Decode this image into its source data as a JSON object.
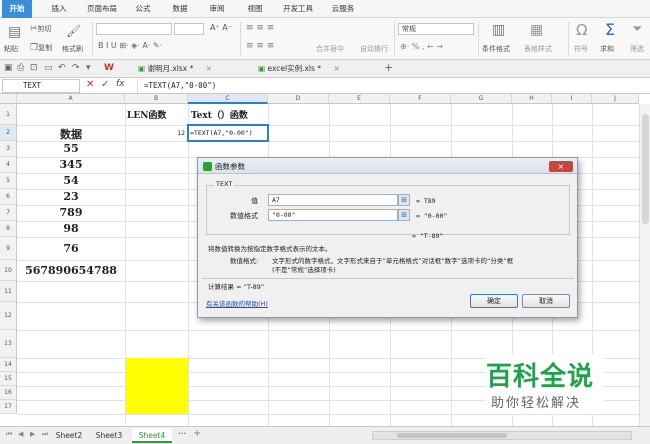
{
  "menu": {
    "tabs": [
      "开始",
      "插入",
      "页面布局",
      "公式",
      "数据",
      "审阅",
      "视图",
      "开发工具",
      "云服务"
    ],
    "active": "开始"
  },
  "ribbon": {
    "cut": "剪切",
    "copy": "复制",
    "format_painter": "格式刷",
    "paste": "粘贴",
    "merge_center": "合并居中",
    "auto_wrap": "自动换行",
    "number_format": "常规",
    "conditional_format": "条件格式",
    "table_style": "表格样式",
    "symbol": "符号",
    "sum": "求和",
    "filter": "筛选"
  },
  "doc_tabs": [
    {
      "label": "谢明月.xlsx *",
      "close": "×"
    },
    {
      "label": "excel实例.xls *",
      "close": "×"
    }
  ],
  "formula_bar": {
    "name_box": "TEXT",
    "fx": "fx",
    "formula": "=TEXT(A7,\"0-00\")"
  },
  "grid": {
    "columns": [
      "A",
      "B",
      "C",
      "D",
      "E",
      "F",
      "G",
      "H",
      "I",
      "J"
    ],
    "rows": [
      "1",
      "2",
      "3",
      "4",
      "5",
      "6",
      "7",
      "8",
      "9",
      "10",
      "11",
      "12",
      "13",
      "14",
      "15",
      "16",
      "17"
    ],
    "cells": {
      "b1": "LEN函数",
      "c1": "Text（）函数",
      "a2": "数据",
      "b2": "12",
      "c2": "=TEXT(A7,\"0-00\")",
      "a3": "55",
      "a4": "345",
      "a5": "54",
      "a6": "23",
      "a7": "789",
      "a8": "98",
      "a9": "76",
      "a10": "567890654788"
    },
    "highlight_color": "#ffff00"
  },
  "sheets": {
    "tabs": [
      "Sheet2",
      "Sheet3",
      "Sheet4"
    ],
    "active": "Sheet4",
    "more": "···",
    "add": "+"
  },
  "dialog": {
    "title": "函数参数",
    "function_name": "TEXT",
    "close": "×",
    "params": [
      {
        "label": "值",
        "value": "A7",
        "result": "= T89"
      },
      {
        "label": "数值格式",
        "value": "\"0-00\"",
        "result": "= \"0-00\""
      }
    ],
    "overall_result": "= \"T-89\"",
    "description": "将数值转换为按指定数字格式表示的文本。",
    "param_desc_label": "数值格式:",
    "param_desc_line1": "文字形式的数字格式，文字形式来自于“单元格格式”对话框“数字”选项卡的“分类”框",
    "param_desc_line2": "(不是“常规”选择项卡)",
    "calc_result_label": "计算结果 = “T-89”",
    "help_link": "有关该函数的帮助(H)",
    "ok": "确定",
    "cancel": "取消"
  },
  "watermark": {
    "line1": "百科全说",
    "line2": "助你轻松解决"
  },
  "colors": {
    "accent": "#3a8fd8",
    "active_sheet": "#2aa12a",
    "selection": "#2a7fd0",
    "watermark": "#1fa24a"
  }
}
